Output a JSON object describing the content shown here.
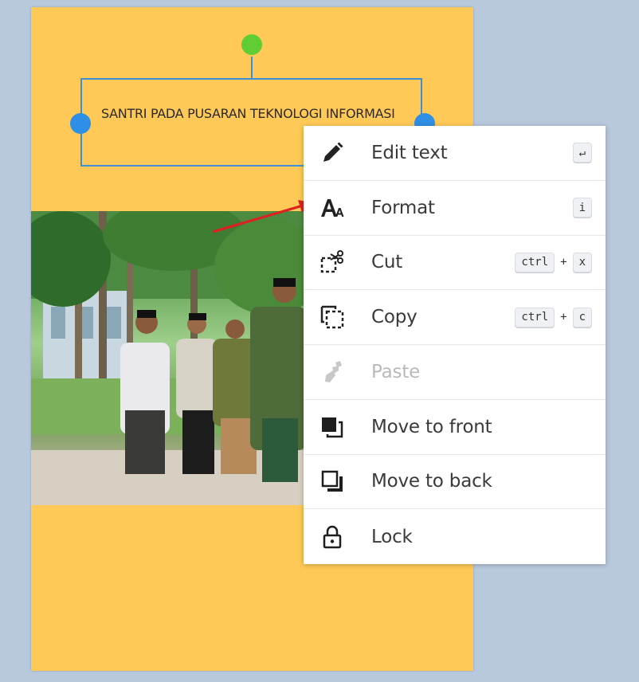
{
  "canvas": {
    "textbox": {
      "text": "SANTRI PADA PUSARAN TEKNOLOGI INFORMASI"
    }
  },
  "context_menu": {
    "items": [
      {
        "label": "Edit text",
        "icon": "pencil-icon",
        "shortcut": [
          "↵"
        ]
      },
      {
        "label": "Format",
        "icon": "format-text-icon",
        "shortcut": [
          "i"
        ]
      },
      {
        "label": "Cut",
        "icon": "cut-icon",
        "shortcut": [
          "ctrl",
          "x"
        ],
        "plus": "+"
      },
      {
        "label": "Copy",
        "icon": "copy-icon",
        "shortcut": [
          "ctrl",
          "c"
        ],
        "plus": "+"
      },
      {
        "label": "Paste",
        "icon": "paste-icon",
        "disabled": true
      },
      {
        "label": "Move to front",
        "icon": "move-front-icon"
      },
      {
        "label": "Move to back",
        "icon": "move-back-icon"
      },
      {
        "label": "Lock",
        "icon": "lock-icon"
      }
    ]
  },
  "colors": {
    "background": "#b8c9dd",
    "page": "#fec957",
    "selection": "#3d8fd6",
    "rotate_handle": "#5fcd33",
    "annotation_arrow": "#e02020"
  }
}
